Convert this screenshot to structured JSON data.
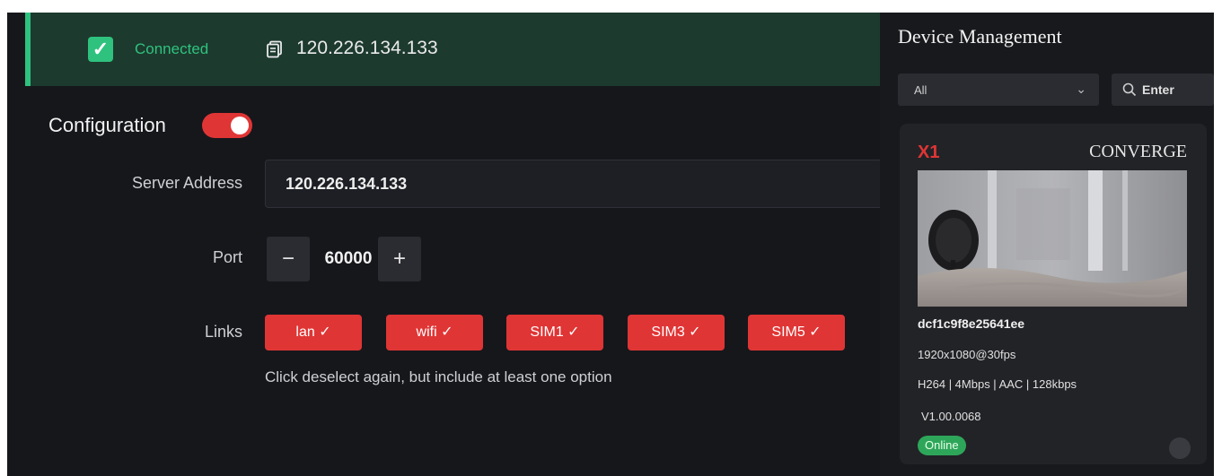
{
  "connection": {
    "status_label": "Connected",
    "ip": "120.226.134.133",
    "status_color": "#2ec27e"
  },
  "config": {
    "title": "Configuration",
    "toggle_on": true,
    "server_address_label": "Server Address",
    "server_address_value": "120.226.134.133",
    "port_label": "Port",
    "port_value": "60000",
    "decrement_symbol": "−",
    "increment_symbol": "+",
    "links_label": "Links",
    "links": [
      {
        "label": "lan ✓"
      },
      {
        "label": "wifi ✓"
      },
      {
        "label": "SIM1 ✓"
      },
      {
        "label": "SIM3 ✓"
      },
      {
        "label": "SIM5 ✓"
      }
    ],
    "links_hint": "Click deselect again, but include at least one option",
    "accent_color": "#e03535"
  },
  "device_management": {
    "title": "Device Management",
    "filter_value": "All",
    "search_placeholder": "Enter",
    "device": {
      "name": "X1",
      "brand": "CONVERGE",
      "id": "dcf1c9f8e25641ee",
      "resolution": "1920x1080@30fps",
      "codec": "H264 | 4Mbps | AAC | 128kbps",
      "version": "V1.00.0068",
      "status": "Online"
    }
  },
  "icons": {
    "check": "checkbox-checked-icon",
    "copy": "copy-icon",
    "chevron": "chevron-down-icon",
    "search": "search-icon"
  }
}
